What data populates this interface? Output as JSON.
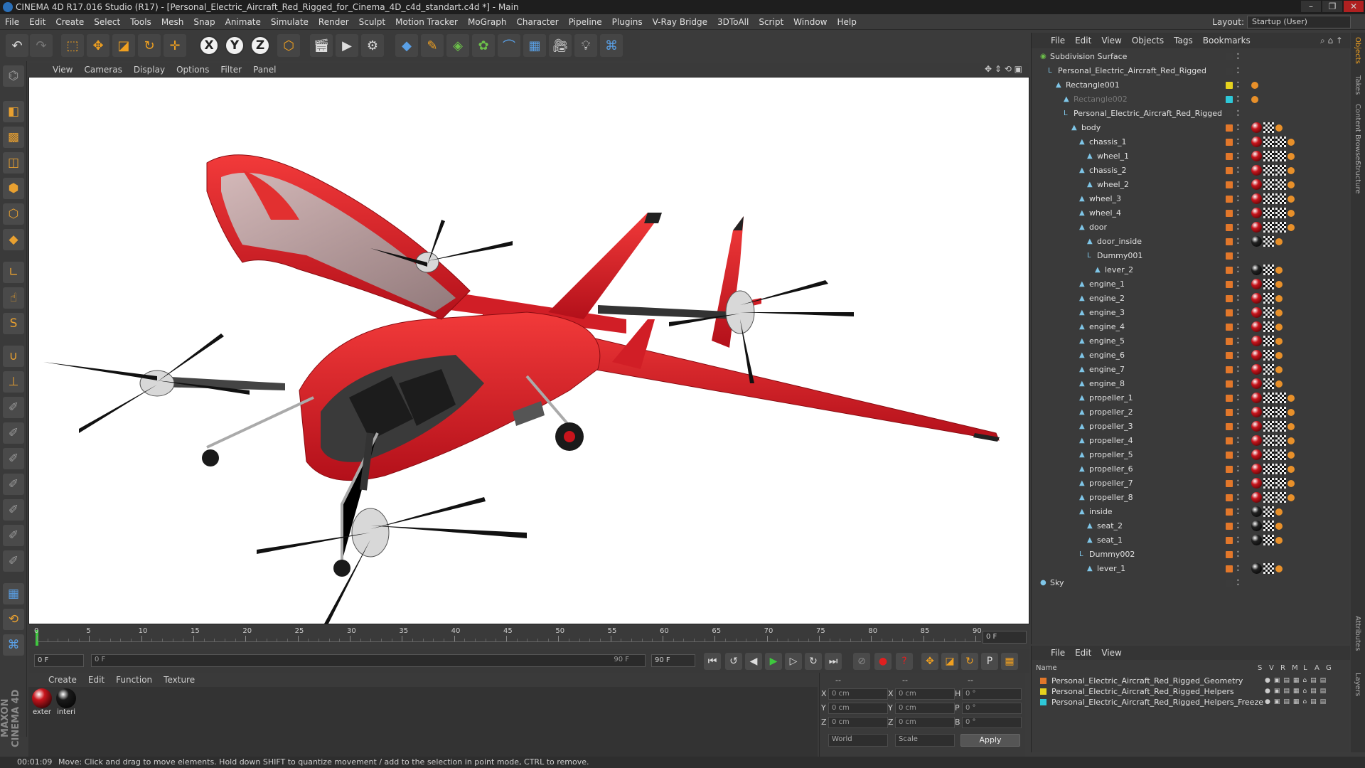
{
  "window": {
    "title": "CINEMA 4D R17.016 Studio (R17) - [Personal_Electric_Aircraft_Red_Rigged_for_Cinema_4D_c4d_standart.c4d *] - Main"
  },
  "menubar": {
    "items": [
      "File",
      "Edit",
      "Create",
      "Select",
      "Tools",
      "Mesh",
      "Snap",
      "Animate",
      "Simulate",
      "Render",
      "Sculpt",
      "Motion Tracker",
      "MoGraph",
      "Character",
      "Pipeline",
      "Plugins",
      "V-Ray Bridge",
      "3DToAll",
      "Script",
      "Window",
      "Help"
    ],
    "layout_label": "Layout:",
    "layout_value": "Startup (User)"
  },
  "viewport_menu": {
    "items": [
      "View",
      "Cameras",
      "Display",
      "Options",
      "Filter",
      "Panel"
    ]
  },
  "timeline": {
    "ticks": [
      "0",
      "5",
      "10",
      "15",
      "20",
      "25",
      "30",
      "35",
      "40",
      "45",
      "50",
      "55",
      "60",
      "65",
      "70",
      "75",
      "80",
      "85",
      "90"
    ],
    "frame_field": "0 F"
  },
  "playbar": {
    "start_field": "0 F",
    "slider_start": "0 F",
    "slider_end": "90 F",
    "end_field": "90 F"
  },
  "material_manager": {
    "menu": [
      "Create",
      "Edit",
      "Function",
      "Texture"
    ],
    "materials": [
      {
        "label": "exter",
        "color": "#c8141c"
      },
      {
        "label": "interi",
        "color": "#1a1a1a"
      }
    ]
  },
  "coordinates": {
    "header": [
      "--",
      "--",
      "--"
    ],
    "rows": [
      {
        "l1": "X",
        "v1": "0 cm",
        "l2": "X",
        "v2": "0 cm",
        "l3": "H",
        "v3": "0 °"
      },
      {
        "l1": "Y",
        "v1": "0 cm",
        "l2": "Y",
        "v2": "0 cm",
        "l3": "P",
        "v3": "0 °"
      },
      {
        "l1": "Z",
        "v1": "0 cm",
        "l2": "Z",
        "v2": "0 cm",
        "l3": "B",
        "v3": "0 °"
      }
    ],
    "mode_select": "World",
    "scale_select": "Scale",
    "apply_label": "Apply"
  },
  "status": {
    "time": "00:01:09",
    "message": "Move: Click and drag to move elements. Hold down SHIFT to quantize movement / add to the selection in point mode, CTRL to remove."
  },
  "object_manager": {
    "menu": [
      "File",
      "Edit",
      "View",
      "Objects",
      "Tags",
      "Bookmarks"
    ],
    "objects": [
      {
        "name": "Subdivision Surface",
        "indent": 0,
        "swatch": "#3b3b3b"
      },
      {
        "name": "Personal_Electric_Aircraft_Red_Rigged",
        "indent": 1,
        "swatch": "#3b3b3b"
      },
      {
        "name": "Rectangle001",
        "indent": 2,
        "swatch": "#e6d21e"
      },
      {
        "name": "Rectangle002",
        "indent": 3,
        "swatch": "#2ec8d8"
      },
      {
        "name": "Personal_Electric_Aircraft_Red_Rigged",
        "indent": 3,
        "swatch": "#3b3b3b"
      },
      {
        "name": "body",
        "indent": 4,
        "swatch": "#e2772a"
      },
      {
        "name": "chassis_1",
        "indent": 5,
        "swatch": "#e2772a"
      },
      {
        "name": "wheel_1",
        "indent": 6,
        "swatch": "#e2772a"
      },
      {
        "name": "chassis_2",
        "indent": 5,
        "swatch": "#e2772a"
      },
      {
        "name": "wheel_2",
        "indent": 6,
        "swatch": "#e2772a"
      },
      {
        "name": "wheel_3",
        "indent": 5,
        "swatch": "#e2772a"
      },
      {
        "name": "wheel_4",
        "indent": 5,
        "swatch": "#e2772a"
      },
      {
        "name": "door",
        "indent": 5,
        "swatch": "#e2772a"
      },
      {
        "name": "door_inside",
        "indent": 6,
        "swatch": "#e2772a"
      },
      {
        "name": "Dummy001",
        "indent": 6,
        "swatch": "#e2772a"
      },
      {
        "name": "lever_2",
        "indent": 7,
        "swatch": "#e2772a"
      },
      {
        "name": "engine_1",
        "indent": 5,
        "swatch": "#e2772a"
      },
      {
        "name": "engine_2",
        "indent": 5,
        "swatch": "#e2772a"
      },
      {
        "name": "engine_3",
        "indent": 5,
        "swatch": "#e2772a"
      },
      {
        "name": "engine_4",
        "indent": 5,
        "swatch": "#e2772a"
      },
      {
        "name": "engine_5",
        "indent": 5,
        "swatch": "#e2772a"
      },
      {
        "name": "engine_6",
        "indent": 5,
        "swatch": "#e2772a"
      },
      {
        "name": "engine_7",
        "indent": 5,
        "swatch": "#e2772a"
      },
      {
        "name": "engine_8",
        "indent": 5,
        "swatch": "#e2772a"
      },
      {
        "name": "propeller_1",
        "indent": 5,
        "swatch": "#e2772a"
      },
      {
        "name": "propeller_2",
        "indent": 5,
        "swatch": "#e2772a"
      },
      {
        "name": "propeller_3",
        "indent": 5,
        "swatch": "#e2772a"
      },
      {
        "name": "propeller_4",
        "indent": 5,
        "swatch": "#e2772a"
      },
      {
        "name": "propeller_5",
        "indent": 5,
        "swatch": "#e2772a"
      },
      {
        "name": "propeller_6",
        "indent": 5,
        "swatch": "#e2772a"
      },
      {
        "name": "propeller_7",
        "indent": 5,
        "swatch": "#e2772a"
      },
      {
        "name": "propeller_8",
        "indent": 5,
        "swatch": "#e2772a"
      },
      {
        "name": "inside",
        "indent": 5,
        "swatch": "#e2772a"
      },
      {
        "name": "seat_2",
        "indent": 6,
        "swatch": "#e2772a"
      },
      {
        "name": "seat_1",
        "indent": 6,
        "swatch": "#e2772a"
      },
      {
        "name": "Dummy002",
        "indent": 5,
        "swatch": "#e2772a"
      },
      {
        "name": "lever_1",
        "indent": 6,
        "swatch": "#e2772a"
      },
      {
        "name": "Sky",
        "indent": 0,
        "swatch": "#3b3b3b"
      }
    ]
  },
  "layer_manager": {
    "menu": [
      "File",
      "Edit",
      "View"
    ],
    "columns": [
      "Name",
      "S",
      "V",
      "R",
      "M",
      "L",
      "A",
      "G"
    ],
    "layers": [
      {
        "name": "Personal_Electric_Aircraft_Red_Rigged_Geometry",
        "color": "#e2772a"
      },
      {
        "name": "Personal_Electric_Aircraft_Red_Rigged_Helpers",
        "color": "#e6d21e"
      },
      {
        "name": "Personal_Electric_Aircraft_Red_Rigged_Helpers_Freeze",
        "color": "#2ec8d8"
      }
    ]
  },
  "right_tabs": [
    "Objects",
    "Takes",
    "Content Browser",
    "Structure",
    "Attributes",
    "Layers"
  ],
  "logo": {
    "text": "MAXON CINEMA 4D"
  }
}
